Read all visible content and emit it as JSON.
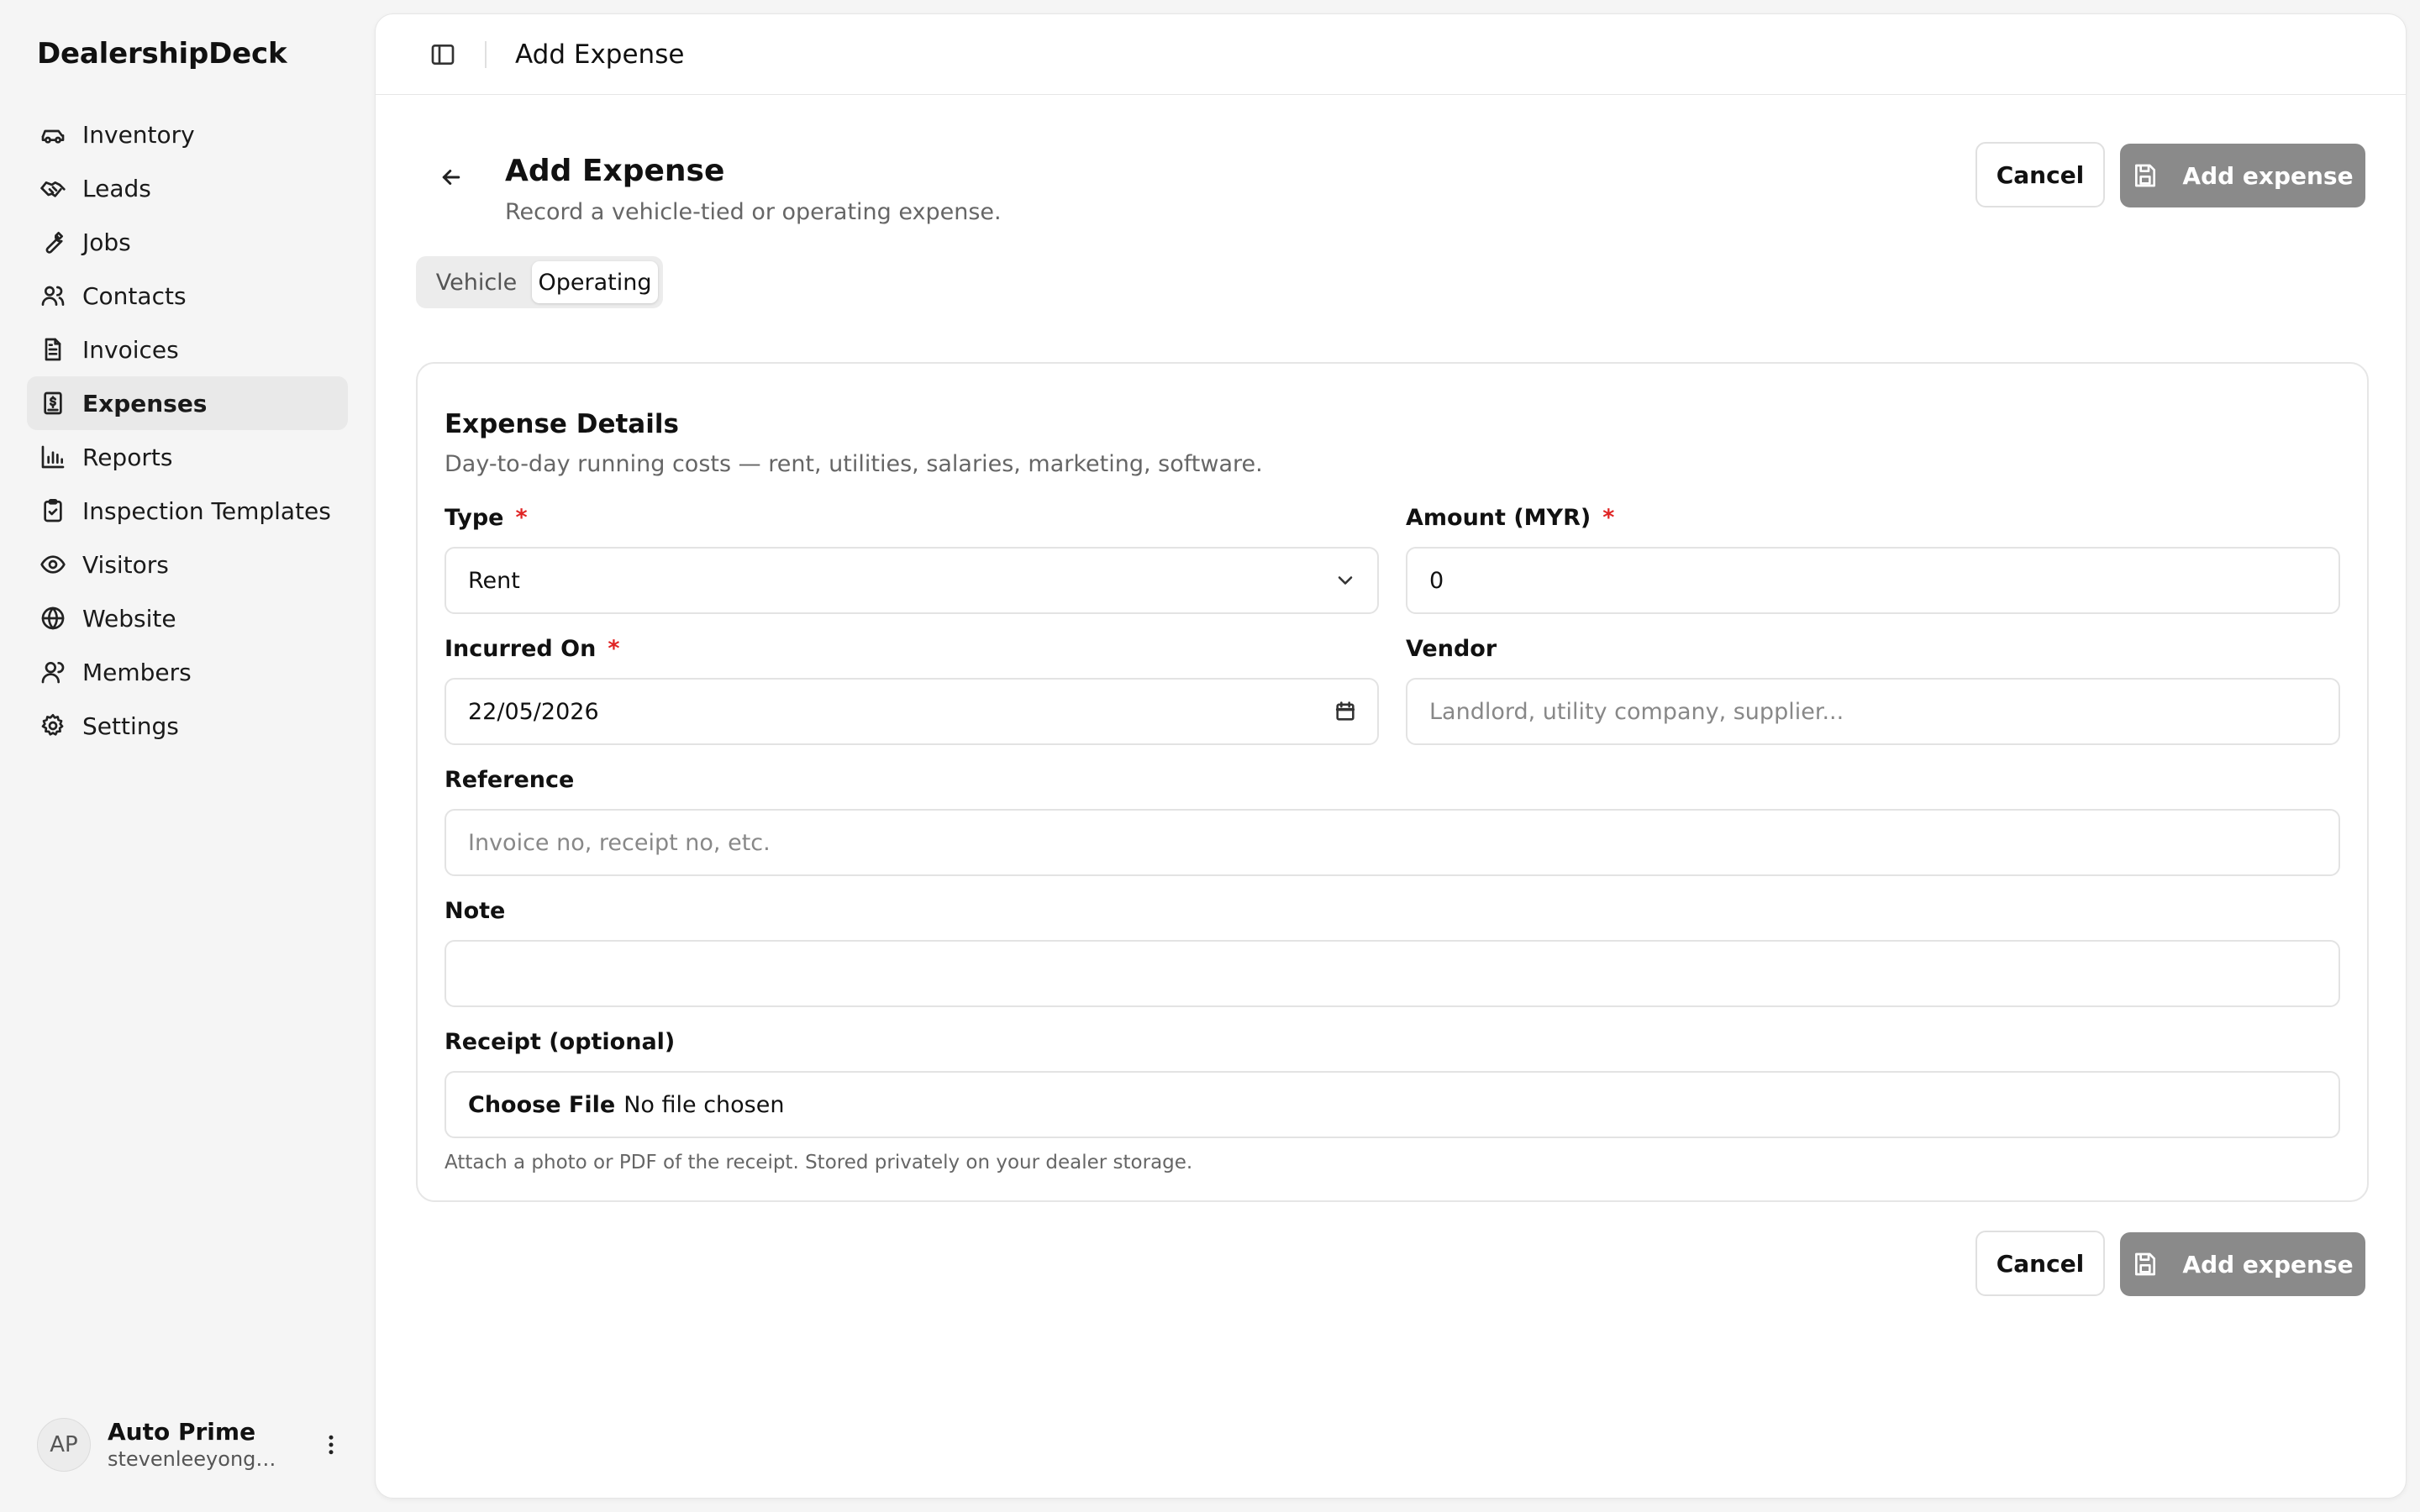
{
  "brand": "DealershipDeck",
  "nav": [
    {
      "label": "Inventory",
      "icon": "car-icon"
    },
    {
      "label": "Leads",
      "icon": "handshake-icon"
    },
    {
      "label": "Jobs",
      "icon": "wrench-icon"
    },
    {
      "label": "Contacts",
      "icon": "users-icon"
    },
    {
      "label": "Invoices",
      "icon": "file-text-icon"
    },
    {
      "label": "Expenses",
      "icon": "receipt-icon",
      "active": true
    },
    {
      "label": "Reports",
      "icon": "bar-chart-icon"
    },
    {
      "label": "Inspection Templates",
      "icon": "clipboard-check-icon"
    },
    {
      "label": "Visitors",
      "icon": "eye-icon"
    },
    {
      "label": "Website",
      "icon": "globe-icon"
    },
    {
      "label": "Members",
      "icon": "user-icon"
    },
    {
      "label": "Settings",
      "icon": "gear-icon"
    }
  ],
  "user": {
    "initials": "AP",
    "name": "Auto Prime",
    "email": "stevenleeyongwa..."
  },
  "topbar": {
    "title": "Add Expense"
  },
  "page": {
    "title": "Add Expense",
    "subtitle": "Record a vehicle-tied or operating expense.",
    "cancel_label": "Cancel",
    "submit_label": "Add expense"
  },
  "tabs": [
    {
      "label": "Vehicle",
      "active": false
    },
    {
      "label": "Operating",
      "active": true
    }
  ],
  "card": {
    "title": "Expense Details",
    "description": "Day-to-day running costs — rent, utilities, salaries, marketing, software."
  },
  "form": {
    "type": {
      "label": "Type",
      "value": "Rent",
      "required": "*"
    },
    "amount": {
      "label": "Amount (MYR)",
      "value": "0",
      "required": "*"
    },
    "incurred_on": {
      "label": "Incurred On",
      "value": "22/05/2026",
      "required": "*"
    },
    "vendor": {
      "label": "Vendor",
      "placeholder": "Landlord, utility company, supplier..."
    },
    "reference": {
      "label": "Reference",
      "placeholder": "Invoice no, receipt no, etc."
    },
    "note": {
      "label": "Note",
      "value": ""
    },
    "receipt": {
      "label": "Receipt (optional)",
      "button": "Choose File",
      "status": "No file chosen",
      "hint": "Attach a photo or PDF of the receipt. Stored privately on your dealer storage."
    }
  },
  "colors": {
    "primary_disabled": "#8a8a8a",
    "required": "#e02424",
    "active_nav_bg": "#e9e9e9"
  }
}
